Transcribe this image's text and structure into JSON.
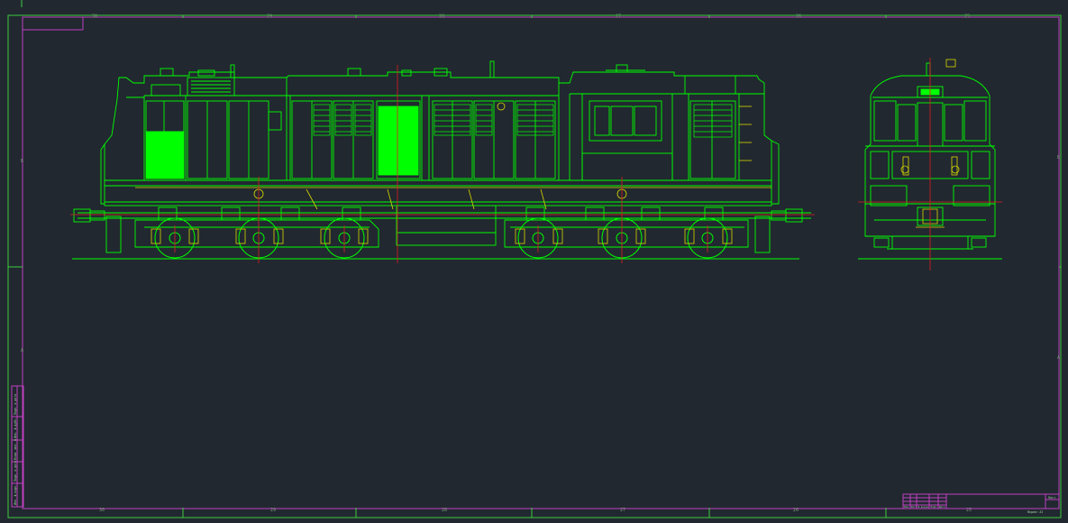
{
  "drawing": {
    "top_zone_labels": [
      "30",
      "29",
      "28",
      "27",
      "26",
      "25"
    ],
    "bottom_zone_labels": [
      "30",
      "29",
      "28",
      "27",
      "26",
      "25"
    ],
    "right_zone_labels": [
      "Б",
      "А"
    ],
    "left_zone_labels": [
      "Б",
      "А"
    ],
    "side_stamp_labels": [
      "Инв. № подл.",
      "Подп. и дата",
      "Взам. инв. №",
      "Инв. № дубл.",
      "Подп. и дата"
    ],
    "title_block": {
      "top_right": "Лист",
      "sign_row": "Изм. Лист № докум. Подп. Дата",
      "format": "Формат А3"
    }
  },
  "colors": {
    "background": "#212830",
    "drawing_line": "#00ff00",
    "fill_panel": "#00ff00",
    "frame_outer": "#3dcc3d",
    "frame_inner": "#c040c0",
    "centerline": "#e02020",
    "detail": "#d8d800"
  }
}
